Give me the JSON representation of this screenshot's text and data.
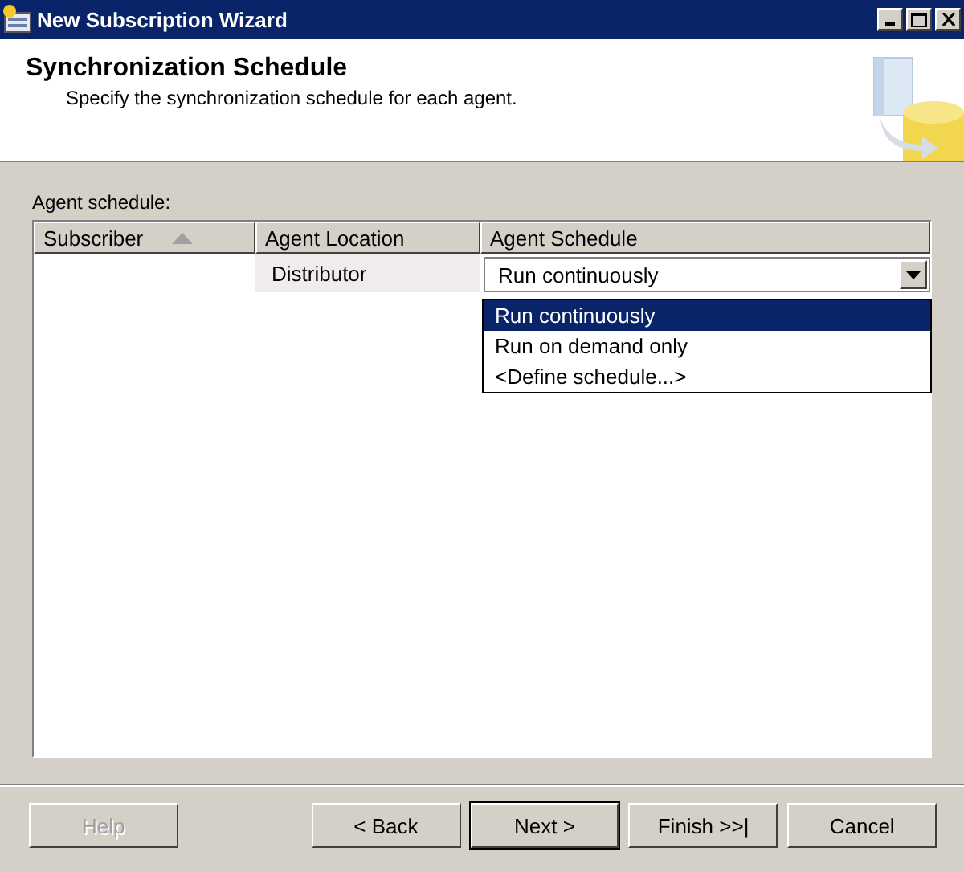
{
  "window": {
    "title": "New Subscription Wizard"
  },
  "header": {
    "title": "Synchronization Schedule",
    "subtitle": "Specify the synchronization schedule for each agent."
  },
  "grid": {
    "label": "Agent schedule:",
    "columns": [
      {
        "label": "Subscriber",
        "sorted": true
      },
      {
        "label": "Agent Location",
        "sorted": false
      },
      {
        "label": "Agent Schedule",
        "sorted": false
      }
    ],
    "rows": [
      {
        "location": "Distributor",
        "schedule": "Run continuously"
      }
    ],
    "dropdown": {
      "expanded": true,
      "options": [
        {
          "label": "Run continuously",
          "selected": true
        },
        {
          "label": "Run on demand only",
          "selected": false
        },
        {
          "label": "<Define schedule...>",
          "selected": false
        }
      ]
    }
  },
  "buttons": [
    {
      "label": "Help",
      "disabled": true,
      "default": false
    },
    {
      "label": "< Back",
      "disabled": false,
      "default": false
    },
    {
      "label": "Next >",
      "disabled": false,
      "default": true
    },
    {
      "label": "Finish >>|",
      "disabled": false,
      "default": false
    },
    {
      "label": "Cancel",
      "disabled": false,
      "default": false
    }
  ]
}
